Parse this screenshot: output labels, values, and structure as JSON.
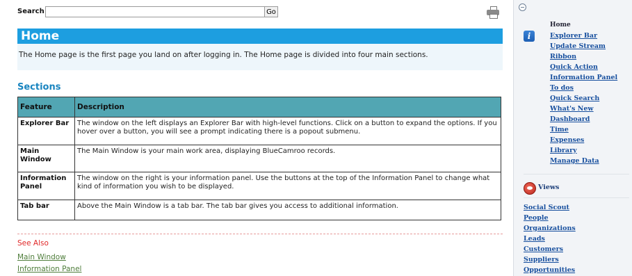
{
  "search": {
    "label": "Search",
    "value": "",
    "go_label": "Go",
    "print_icon": "printer-icon"
  },
  "page": {
    "title": "Home",
    "intro": "The Home page is the first page you land on after logging in. The Home page is divided into four main sections.",
    "sections_heading": "Sections"
  },
  "table": {
    "headers": [
      "Feature",
      "Description"
    ],
    "rows": [
      {
        "feature": "Explorer Bar",
        "description": "The window on the left displays an Explorer Bar with high-level functions. Click on a button to expand the options. If you hover over a button, you will see a prompt indicating there is a popout submenu."
      },
      {
        "feature": "Main Window",
        "description": "The Main Window is your main work area, displaying BlueCamroo records."
      },
      {
        "feature": "Information Panel",
        "description": "The window on the right is your information panel. Use the buttons at the top of the Information Panel to change what kind of information you wish to be displayed."
      },
      {
        "feature": "Tab bar",
        "description": "Above the Main Window is a tab bar. The tab bar gives you access to additional information."
      }
    ]
  },
  "see_also": {
    "heading": "See Also",
    "links": [
      "Main Window",
      "Information Panel"
    ]
  },
  "sidebar": {
    "collapse_icon": "collapse-icon",
    "home_heading": "Home",
    "home_links": [
      "Explorer Bar",
      "Update Stream",
      "Ribbon",
      "Quick Action",
      "Information Panel",
      "To dos",
      "Quick Search",
      "What's New",
      "Dashboard",
      "Time",
      "Expenses",
      "Library",
      "Manage Data"
    ],
    "views_label": "Views",
    "view_links": [
      "Social Scout",
      "People",
      "Organizations",
      "Leads",
      "Customers",
      "Suppliers",
      "Opportunities"
    ]
  },
  "colors": {
    "title_bar": "#1d9ee0",
    "table_header": "#52a6b3",
    "see_also": "#e02828",
    "sidebar_link": "#174f9e"
  }
}
